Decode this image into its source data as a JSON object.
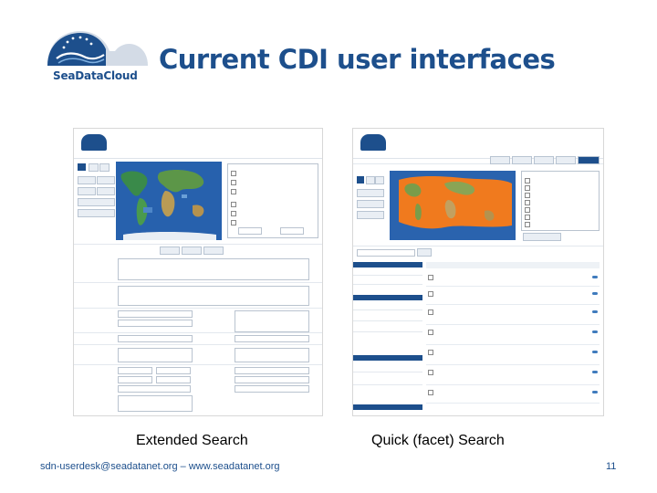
{
  "slide": {
    "title": "Current CDI user interfaces",
    "logo_text": "SeaDataCloud",
    "footer": "sdn-userdesk@seadatanet.org – www.seadatanet.org",
    "page_number": "11"
  },
  "panels": {
    "left_caption": "Extended Search",
    "right_caption": "Quick (facet) Search"
  },
  "colors": {
    "brand_blue": "#1d4f8c",
    "accent_orange": "#f07a1e",
    "ocean": "#1e5aa8"
  }
}
